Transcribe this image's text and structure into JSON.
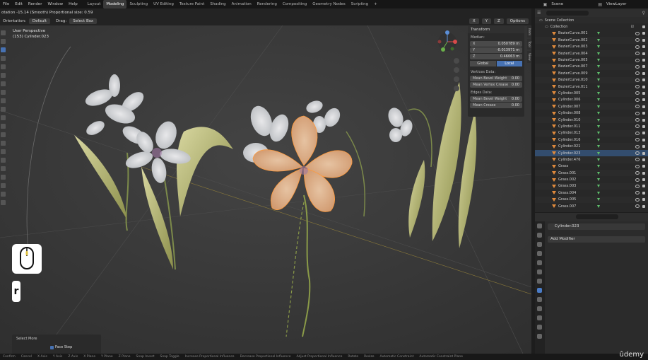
{
  "topbar": {
    "menus": [
      "File",
      "Edit",
      "Render",
      "Window",
      "Help"
    ],
    "workspaces": [
      "Layout",
      "Modeling",
      "Sculpting",
      "UV Editing",
      "Texture Paint",
      "Shading",
      "Animation",
      "Rendering",
      "Compositing",
      "Geometry Nodes",
      "Scripting",
      "+"
    ],
    "active_workspace": "Modeling",
    "scene": "Scene",
    "view_layer": "ViewLayer"
  },
  "header": {
    "op_text": "otation -15.14 (Smooth) Proportional size: 0.59",
    "orientation_label": "Orientation:",
    "orientation_value": "Default",
    "drag_label": "Drag:",
    "drag_value": "Select Box",
    "axes": [
      "X",
      "Y",
      "Z"
    ],
    "options": "Options"
  },
  "viewport": {
    "view_name": "User Perspective",
    "object_info": "(153) Cylinder.023"
  },
  "npanel": {
    "title": "Transform",
    "median": "Median:",
    "x_label": "X",
    "x_value": "0.050789 m",
    "y_label": "Y",
    "y_value": "-0.013971 m",
    "z_label": "Z",
    "z_value": "0.46063 m",
    "global": "Global",
    "local": "Local",
    "vertices_data": "Vertices Data:",
    "mean_bevel_weight_v": "Mean Bevel Weight",
    "mbw_v_val": "0.00",
    "mean_vertex_crease": "Mean Vertex Crease",
    "mvc_val": "0.00",
    "edges_data": "Edges Data:",
    "mean_bevel_weight_e": "Mean Bevel Weight",
    "mbw_e_val": "0.00",
    "mean_crease": "Mean Crease",
    "mc_val": "0.00",
    "tabs": [
      "Item",
      "Tool",
      "View"
    ]
  },
  "outliner": {
    "scene_collection": "Scene Collection",
    "collection": "Collection",
    "items": [
      "BezierCurve.001",
      "BezierCurve.002",
      "BezierCurve.003",
      "BezierCurve.004",
      "BezierCurve.005",
      "BezierCurve.007",
      "BezierCurve.009",
      "BezierCurve.010",
      "BezierCurve.011",
      "Cylinder.005",
      "Cylinder.006",
      "Cylinder.007",
      "Cylinder.008",
      "Cylinder.010",
      "Cylinder.011",
      "Cylinder.013",
      "Cylinder.016",
      "Cylinder.021",
      "Cylinder.023",
      "Cylinder.476",
      "Grass",
      "Grass.001",
      "Grass.002",
      "Grass.003",
      "Grass.004",
      "Grass.005",
      "Grass.007"
    ],
    "selected": "Cylinder.023"
  },
  "properties": {
    "object_name": "Cylinder.023",
    "add_modifier": "Add Modifier"
  },
  "lastop": {
    "title": "Select More",
    "face_step": "Face Step"
  },
  "screencast": {
    "key": "r"
  },
  "status": [
    "Confirm",
    "Cancel",
    "X Axis",
    "Y Axis",
    "Z Axis",
    "X Plane",
    "Y Plane",
    "Z Plane",
    "Snap Invert",
    "Snap Toggle",
    "Increase Proportional Influence",
    "Decrease Proportional Influence",
    "Adjust Proportional Influence",
    "Rotate",
    "Resize",
    "Automatic Constraint",
    "Automatic Constraint Plane"
  ],
  "watermark": "ûdemy"
}
